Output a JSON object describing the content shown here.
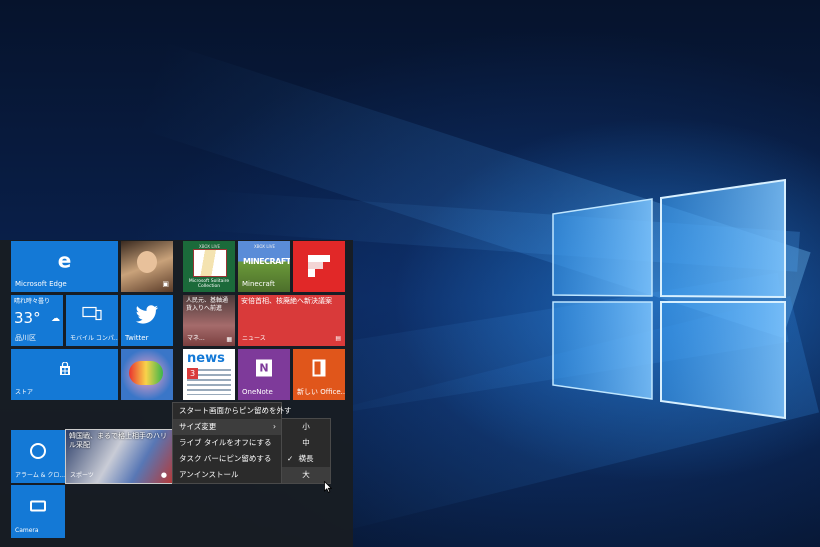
{
  "tiles": {
    "edge": "Microsoft Edge",
    "weather_title": "晴れ時々曇り",
    "weather_temp": "33°",
    "weather_city": "品川区",
    "mobile_companion": "モバイル コンパ...",
    "twitter": "Twitter",
    "store": "ストア",
    "xbox_live_1": "XBOX LIVE",
    "xbox_live_2": "XBOX LIVE",
    "solitaire": "Microsoft Solitaire Collection",
    "minecraft": "Minecraft",
    "money_headline": "人民元、基軸通貨入りへ前進",
    "money_label": "マネ...",
    "news_headline": "安倍首相、核廃絶へ新決議案",
    "news_label": "ニュース",
    "news_app": "news",
    "onenote": "OneNote",
    "office": "新しい Office...",
    "alarm": "アラーム & クロ...",
    "sports_headline": "韓国戦、まるで格上相手のハリル采配",
    "sports_label": "スポーツ",
    "camera": "Camera"
  },
  "context_menu": {
    "unpin_start": "スタート画面からピン留めを外す",
    "resize": "サイズ変更",
    "live_tile_off": "ライブ タイルをオフにする",
    "pin_taskbar": "タスク バーにピン留めする",
    "uninstall": "アンインストール"
  },
  "size_menu": {
    "small": "小",
    "medium": "中",
    "wide": "横長",
    "large": "大",
    "checked": "横長"
  },
  "colors": {
    "tile_blue": "#1479d6",
    "flipboard_red": "#e12828",
    "news_red": "#d93a3a",
    "onenote_purple": "#7e3a9a",
    "office_orange": "#e0561b",
    "menu_bg": "#2b2b2b",
    "start_bg": "#181d23"
  }
}
